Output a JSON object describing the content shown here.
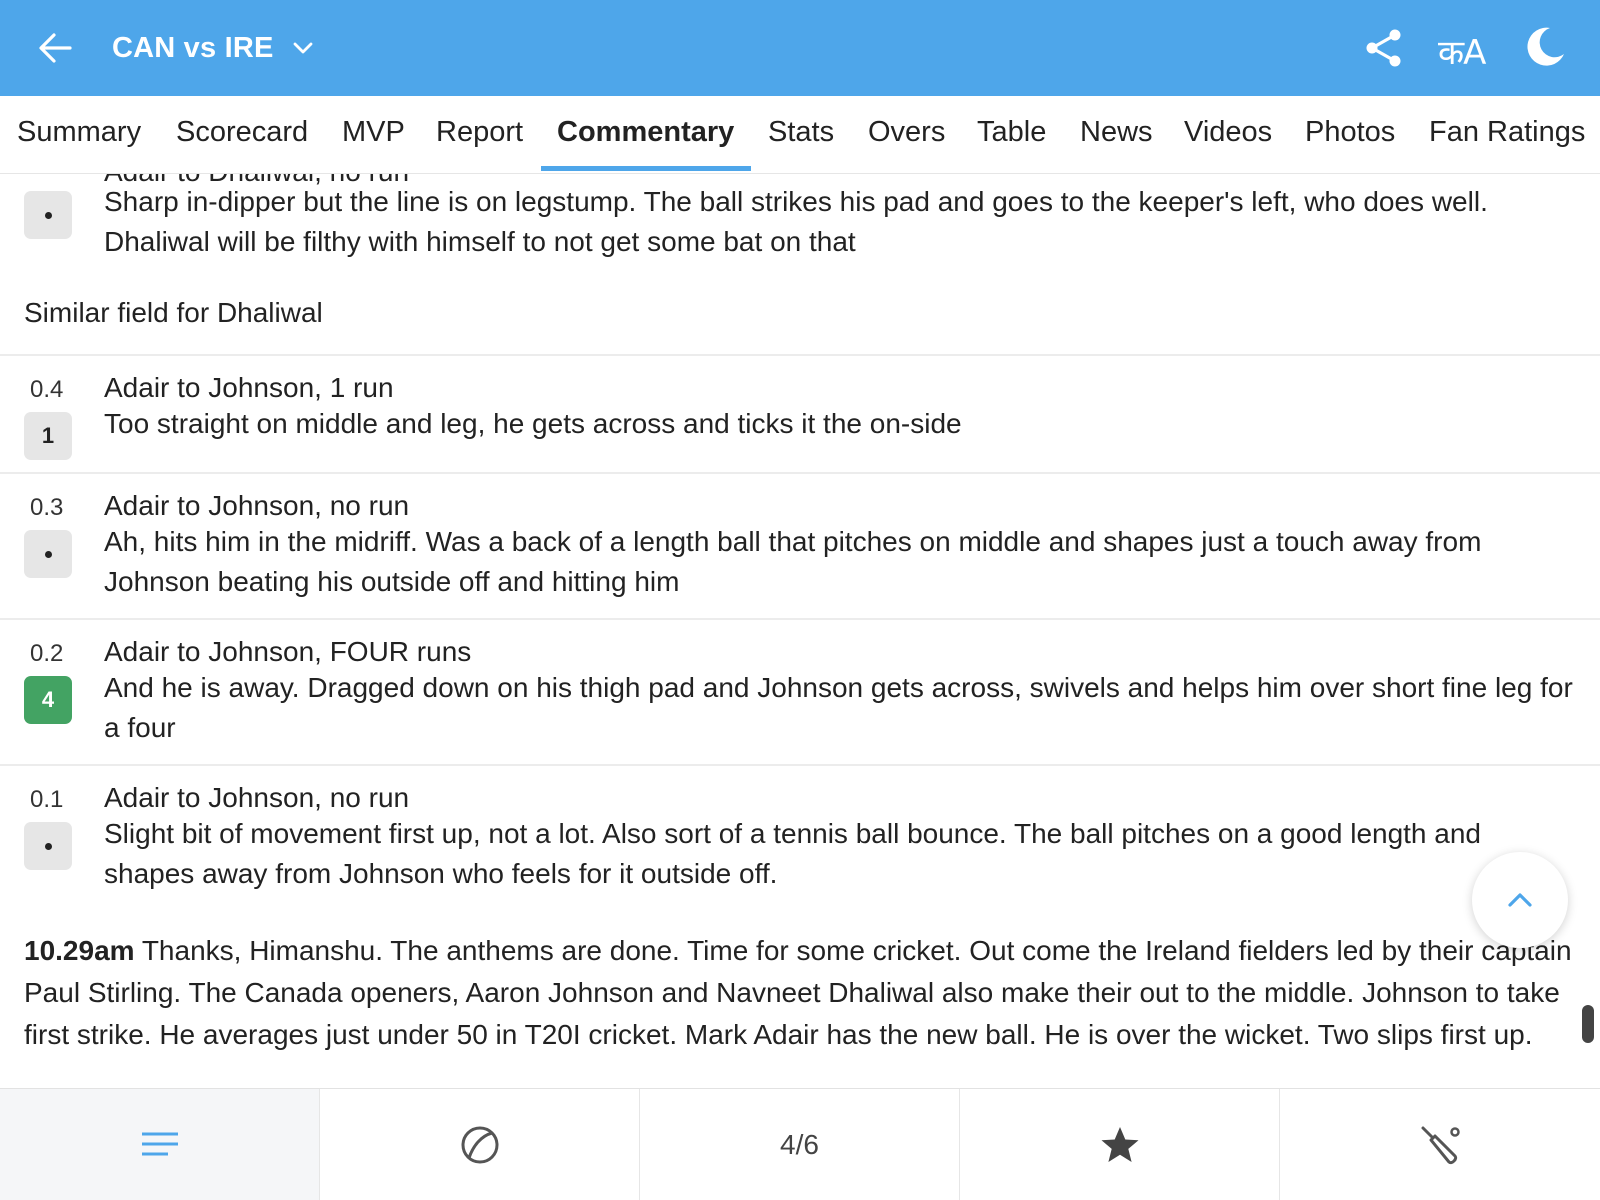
{
  "header": {
    "title": "CAN vs IRE",
    "language_toggle": "कA",
    "icons": [
      "back-arrow-icon",
      "chevron-down-icon",
      "share-icon",
      "language-icon",
      "moon-icon"
    ],
    "background_color": "#4ea6ea"
  },
  "tabs": [
    {
      "label": "Summary"
    },
    {
      "label": "Scorecard"
    },
    {
      "label": "MVP"
    },
    {
      "label": "Report"
    },
    {
      "label": "Commentary",
      "active": true
    },
    {
      "label": "Stats"
    },
    {
      "label": "Overs"
    },
    {
      "label": "Table"
    },
    {
      "label": "News"
    },
    {
      "label": "Videos"
    },
    {
      "label": "Photos"
    },
    {
      "label": "Fan Ratings"
    }
  ],
  "feed": {
    "clipped_heading": "Adair to Dhaliwal, no run",
    "top_entry": {
      "ball": "•",
      "text": "Sharp in-dipper but the line is on legstump. The ball strikes his pad and goes to the keeper's left, who does well. Dhaliwal will be filthy with himself to not get some bat on that"
    },
    "note": "Similar field for Dhaliwal",
    "entries": [
      {
        "over": "0.4",
        "ball": "1",
        "type": "run",
        "heading": "Adair to Johnson, 1 run",
        "text": "Too straight on middle and leg, he gets across and ticks it the on-side"
      },
      {
        "over": "0.3",
        "ball": "•",
        "type": "dot",
        "heading": "Adair to Johnson, no run",
        "text": "Ah, hits him in the midriff. Was a back of a length ball that pitches on middle and shapes just a touch away from Johnson beating his outside off and hitting him"
      },
      {
        "over": "0.2",
        "ball": "4",
        "type": "four",
        "heading": "Adair to Johnson, FOUR runs",
        "text": "And he is away. Dragged down on his thigh pad and Johnson gets across, swivels and helps him over short fine leg for a four"
      },
      {
        "over": "0.1",
        "ball": "•",
        "type": "dot",
        "heading": "Adair to Johnson, no run",
        "text": "Slight bit of movement first up, not a lot. Also sort of a tennis ball bounce. The ball pitches on a good length and shapes away from Johnson who feels for it outside off."
      }
    ],
    "update": {
      "time": "10.29am",
      "text": " Thanks, Himanshu. The anthems are done. Time for some cricket. Out come the Ireland fielders led by their captain Paul Stirling. The Canada openers, Aaron Johnson and Navneet Dhaliwal also make their out to the middle. Johnson to take first strike. He averages just under 50 in T20I cricket. Mark Adair has the new ball. He is over the wicket. Two slips first up."
    },
    "colors": {
      "four_badge": "#43a363",
      "dot_badge": "#e6e6e6"
    }
  },
  "bottom_bar": {
    "items": [
      "menu-lines-icon",
      "cricket-ball-icon",
      "4/6",
      "star-icon",
      "cricket-bat-icon"
    ],
    "page_indicator": "4/6"
  }
}
